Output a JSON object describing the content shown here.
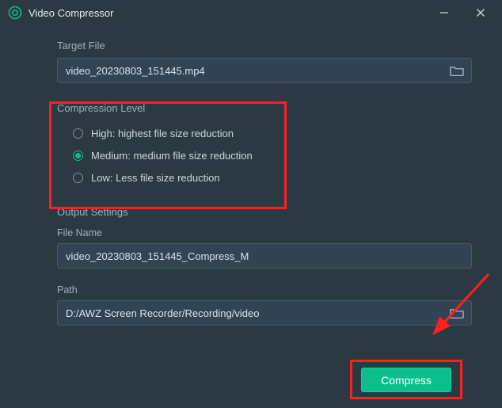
{
  "window": {
    "title": "Video Compressor"
  },
  "target_file": {
    "label": "Target File",
    "value": "video_20230803_151445.mp4"
  },
  "compression": {
    "label": "Compression Level",
    "options": [
      {
        "label": "High: highest file size reduction",
        "selected": false
      },
      {
        "label": "Medium: medium file size reduction",
        "selected": true
      },
      {
        "label": "Low: Less file size reduction",
        "selected": false
      }
    ]
  },
  "output": {
    "section_label": "Output Settings",
    "filename_label": "File Name",
    "filename_value": "video_20230803_151445_Compress_M",
    "path_label": "Path",
    "path_value": "D:/AWZ Screen Recorder/Recording/video"
  },
  "actions": {
    "compress_label": "Compress"
  },
  "colors": {
    "accent": "#0bbf8a",
    "highlight": "#ff1f1f",
    "bg": "#2b3a42"
  }
}
